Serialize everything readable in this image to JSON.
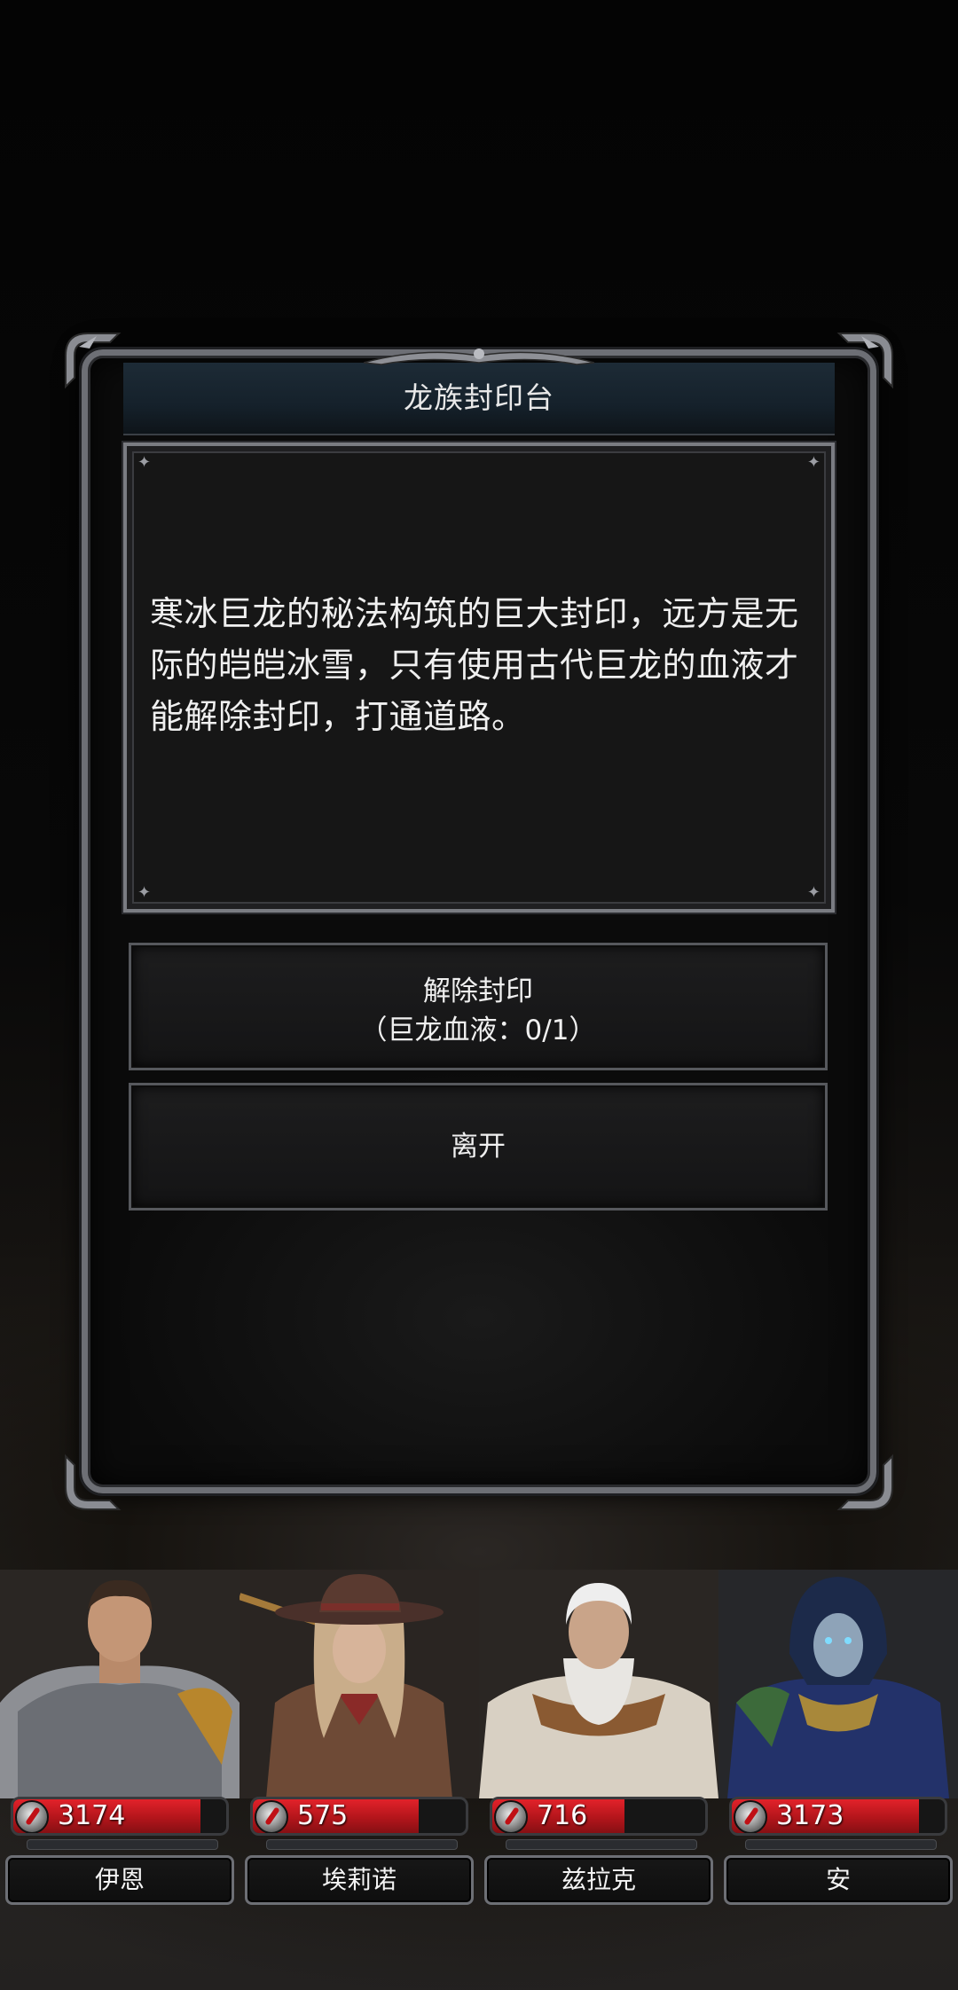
{
  "dialog": {
    "title": "龙族封印台",
    "description": "寒冰巨龙的秘法构筑的巨大封印，远方是无际的皑皑冰雪，只有使用古代巨龙的血液才能解除封印，打通道路。",
    "choices": [
      {
        "label": "解除封印",
        "sublabel": "（巨龙血液：0/1）"
      },
      {
        "label": "离开"
      }
    ]
  },
  "party": [
    {
      "name": "伊恩",
      "hp": "3174",
      "hp_fraction": 0.88,
      "portrait": "armored-warrior-portrait"
    },
    {
      "name": "埃莉诺",
      "hp": "575",
      "hp_fraction": 0.78,
      "portrait": "cowgirl-gunslinger-portrait"
    },
    {
      "name": "兹拉克",
      "hp": "716",
      "hp_fraction": 0.62,
      "portrait": "white-bearded-mage-portrait"
    },
    {
      "name": "安",
      "hp": "3173",
      "hp_fraction": 0.88,
      "portrait": "hooded-blue-sorceress-portrait"
    }
  ],
  "colors": {
    "hp_red": "#d61e25",
    "frame_silver": "#6d6f75",
    "title_bar": "#1d2b36"
  }
}
